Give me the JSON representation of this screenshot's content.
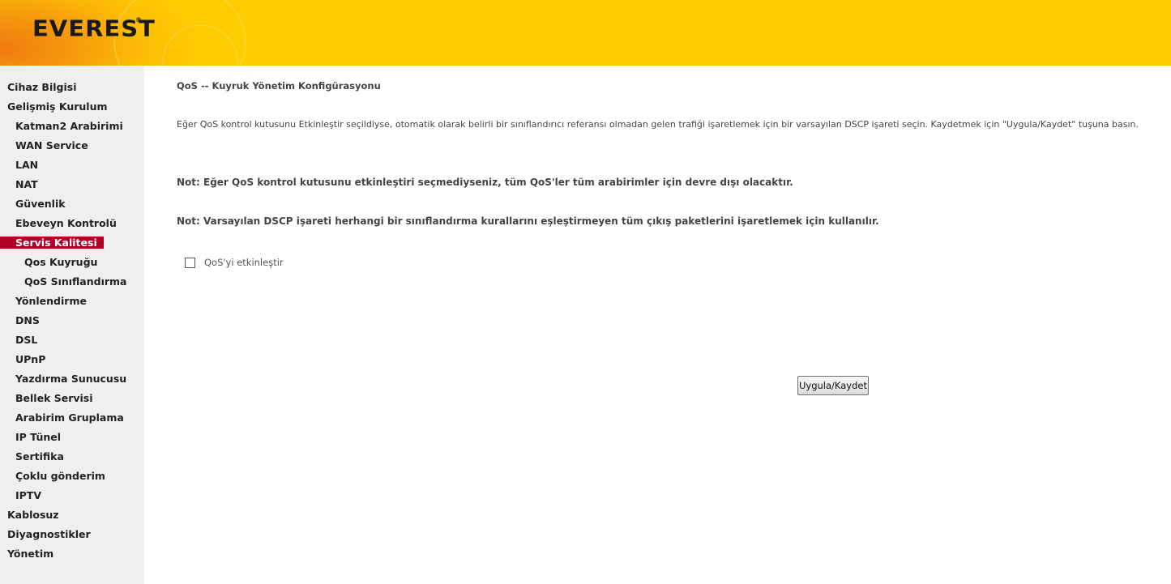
{
  "header": {
    "logo_text": "EVEREST",
    "logo_reg": "®",
    "colors": {
      "header_bg": "#ffcc00",
      "header_glow": "#f07a10",
      "active_menu": "#b00027"
    }
  },
  "sidebar": {
    "items": [
      {
        "label": "Cihaz Bilgisi",
        "level": 0,
        "active": false
      },
      {
        "label": "Gelişmiş Kurulum",
        "level": 0,
        "active": false
      },
      {
        "label": "Katman2 Arabirimi",
        "level": 1,
        "active": false
      },
      {
        "label": "WAN Service",
        "level": 1,
        "active": false
      },
      {
        "label": "LAN",
        "level": 1,
        "active": false
      },
      {
        "label": "NAT",
        "level": 1,
        "active": false
      },
      {
        "label": "Güvenlik",
        "level": 1,
        "active": false
      },
      {
        "label": "Ebeveyn Kontrolü",
        "level": 1,
        "active": false
      },
      {
        "label": "Servis Kalitesi",
        "level": 1,
        "active": true
      },
      {
        "label": "Qos Kuyruğu",
        "level": 2,
        "active": false
      },
      {
        "label": "QoS Sınıflandırma",
        "level": 2,
        "active": false
      },
      {
        "label": "Yönlendirme",
        "level": 1,
        "active": false
      },
      {
        "label": "DNS",
        "level": 1,
        "active": false
      },
      {
        "label": "DSL",
        "level": 1,
        "active": false
      },
      {
        "label": "UPnP",
        "level": 1,
        "active": false
      },
      {
        "label": "Yazdırma Sunucusu",
        "level": 1,
        "active": false
      },
      {
        "label": "Bellek Servisi",
        "level": 1,
        "active": false
      },
      {
        "label": "Arabirim Gruplama",
        "level": 1,
        "active": false
      },
      {
        "label": "IP Tünel",
        "level": 1,
        "active": false
      },
      {
        "label": "Sertifika",
        "level": 1,
        "active": false
      },
      {
        "label": "Çoklu gönderim",
        "level": 1,
        "active": false
      },
      {
        "label": "IPTV",
        "level": 1,
        "active": false
      },
      {
        "label": "Kablosuz",
        "level": 0,
        "active": false
      },
      {
        "label": "Diyagnostikler",
        "level": 0,
        "active": false
      },
      {
        "label": "Yönetim",
        "level": 0,
        "active": false
      }
    ]
  },
  "main": {
    "title": "QoS -- Kuyruk Yönetim Konfigürasyonu",
    "description": "Eğer QoS kontrol kutusunu Etkinleştir seçildiyse, otomatik olarak belirli bir sınıflandırıcı referansı olmadan gelen trafiği işaretlemek için bir varsayılan DSCP işareti seçin. Kaydetmek için \"Uygula/Kaydet\" tuşuna basın.",
    "note1": "Not: Eğer QoS kontrol kutusunu etkinleştiri seçmediyseniz, tüm QoS'ler tüm arabirimler için devre dışı olacaktır.",
    "note2": "Not: Varsayılan DSCP işareti herhangi bir sınıflandırma kurallarını eşleştirmeyen tüm çıkış paketlerini işaretlemek için kullanılır.",
    "enable_qos_label": "QoS'yi etkinleştir",
    "enable_qos_checked": false,
    "apply_button": "Uygula/Kaydet"
  }
}
